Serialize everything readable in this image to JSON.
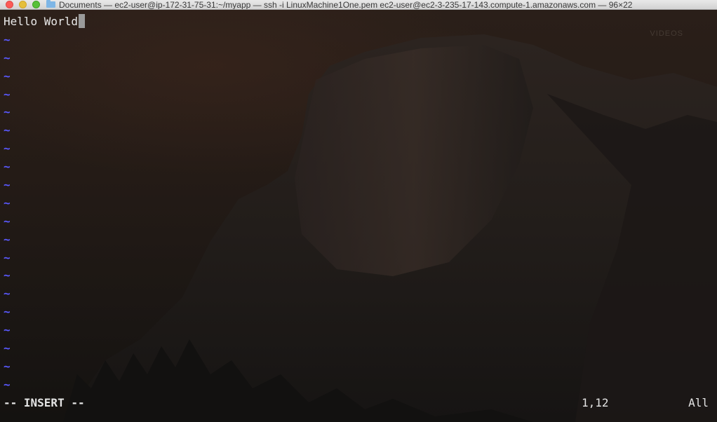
{
  "window": {
    "title": "Documents — ec2-user@ip-172-31-75-31:~/myapp — ssh -i LinuxMachine1One.pem ec2-user@ec2-3-235-17-143.compute-1.amazonaws.com — 96×22",
    "folder_icon": "folder-icon"
  },
  "editor": {
    "lines": [
      "Hello World"
    ],
    "empty_line_marker": "~",
    "empty_line_count": 20,
    "cursor_after_text": true,
    "colors": {
      "text": "#e9e9e9",
      "tilde": "#5a59ff",
      "cursor": "#9a9a9a"
    }
  },
  "statusline": {
    "mode": "-- INSERT --",
    "position": "1,12",
    "scroll": "All"
  },
  "watermark": "VIDEOS"
}
